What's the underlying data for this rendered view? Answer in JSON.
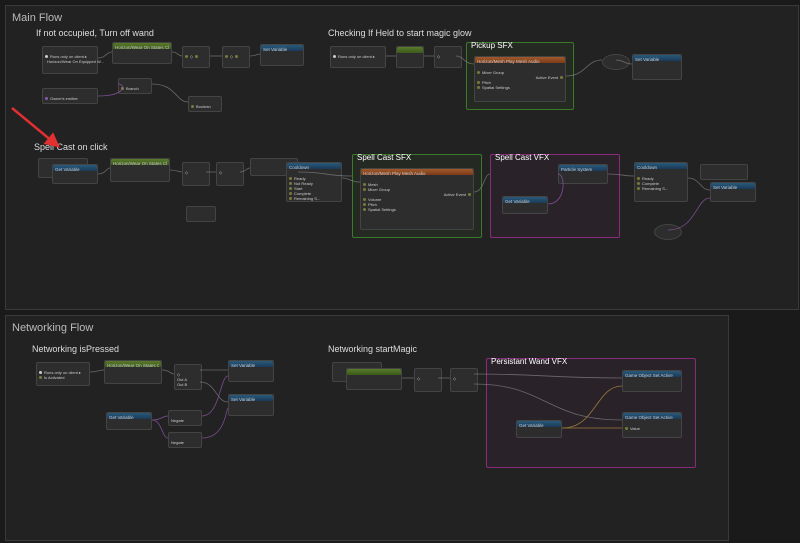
{
  "sections": {
    "main": {
      "title": "Main Flow"
    },
    "networking": {
      "title": "Networking Flow"
    }
  },
  "subsections": {
    "wand_off": "If not occupied, Turn off wand",
    "check_held": "Checking If Held to start magic glow",
    "spell_cast": "Spell Cast on click",
    "net_pressed": "Networking isPressed",
    "net_magic": "Networking startMagic"
  },
  "groups": {
    "pickup_sfx": {
      "title": "Pickup SFX",
      "color": "#3a7a2a"
    },
    "cast_sfx": {
      "title": "Spell Cast SFX",
      "color": "#3a7a2a"
    },
    "cast_vfx": {
      "title": "Spell Cast VFX",
      "color": "#8a2a7a"
    },
    "wand_vfx": {
      "title": "Persistant Wand VFX",
      "color": "#8a2a7a"
    }
  },
  "nodes": {
    "runs_on": "Runs only on client ▸",
    "on_equipped": "Horizon/Wear\\nOn Equipped W...",
    "on_state_change": "Horizon/Wear\\nOn States Change\\nEvent",
    "emitter": "Owner's emitter",
    "play_mesh_audio": "Horizon/Mesh\\nPlay Mesh Audio",
    "cooldown": "Cooldown",
    "get_variable": "Get Variable",
    "set_variable": "Set Variable",
    "branch": "Branch",
    "boolean": "Boolean",
    "negate": "Negate",
    "particle": "Particle System",
    "set_active": "Game Object\\nSet Active",
    "ready": "Ready",
    "not_ready": "Not Ready",
    "start": "Start",
    "complete": "Complete",
    "remaining": "Remaining S...",
    "active_event": "Active Event",
    "pitch": "Pitch",
    "spatial": "Spatial Settings",
    "volume": "Volume",
    "mesh": "Mesh",
    "mixer": "Mixer Group",
    "out_a": "Out A",
    "out_b": "Out B",
    "value": "Value",
    "is_activated": "Is Activated"
  }
}
